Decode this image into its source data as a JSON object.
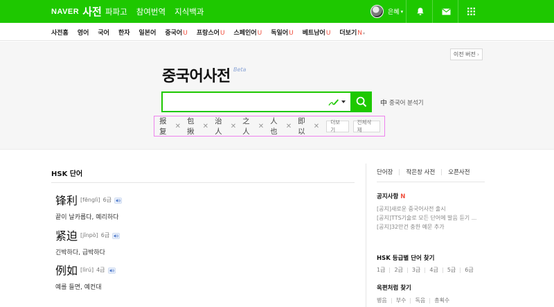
{
  "header": {
    "brand": "NAVER",
    "service": "사전",
    "nav": [
      "파파고",
      "참여번역",
      "지식백과"
    ],
    "user": "은혜",
    "icons": [
      "bell-icon",
      "mail-icon",
      "apps-grid-icon"
    ],
    "colors": {
      "brand_green": "#1ec800"
    }
  },
  "langs": [
    {
      "label": "사전홈",
      "mark": ""
    },
    {
      "label": "영어",
      "mark": ""
    },
    {
      "label": "국어",
      "mark": ""
    },
    {
      "label": "한자",
      "mark": ""
    },
    {
      "label": "일본어",
      "mark": ""
    },
    {
      "label": "중국어",
      "mark": "U"
    },
    {
      "label": "프랑스어",
      "mark": "U"
    },
    {
      "label": "스페인어",
      "mark": "U"
    },
    {
      "label": "독일어",
      "mark": "U"
    },
    {
      "label": "베트남어",
      "mark": "U"
    },
    {
      "label": "더보기",
      "mark": "N"
    }
  ],
  "hero": {
    "prev_version": "이전 버전",
    "title": "중국어사전",
    "beta": "Beta",
    "search_value": "",
    "analyzer_glyph": "中",
    "analyzer_label": "중국어 분석기",
    "recent": [
      "报复",
      "包揪",
      "治人",
      "之人",
      "人也",
      "即以"
    ],
    "more": "더보기",
    "delete_all": "전체삭제"
  },
  "hsk": {
    "title": "HSK 단어",
    "words": [
      {
        "hz": "锋利",
        "py": "[fēnglì]",
        "level": "6급",
        "meaning": "끝이 날카롭다, 예리하다"
      },
      {
        "hz": "紧迫",
        "py": "[jǐnpò]",
        "level": "6급",
        "meaning": "긴박하다, 급박하다"
      },
      {
        "hz": "例如",
        "py": "[lìrú]",
        "level": "4급",
        "meaning": "예를 들면, 예컨대"
      }
    ]
  },
  "side": {
    "tabs": [
      "단어장",
      "작은창 사전",
      "오픈사전"
    ],
    "notice_title": "공지사항",
    "notice_mark": "N",
    "notices": [
      "[공지]새로운 중국어사전 출시",
      "[공지]TTS기술로 모든 단어에 발음 듣기 ...",
      "[공지]32만건 충한 예문 추가"
    ],
    "hsk_levels_title": "HSK 등급별 단어 찾기",
    "levels": [
      "1급",
      "2급",
      "3급",
      "4급",
      "5급",
      "6급"
    ],
    "radical_title": "옥편처럼 찾기",
    "radicals": [
      "병음",
      "부수",
      "독음",
      "총획수"
    ]
  }
}
